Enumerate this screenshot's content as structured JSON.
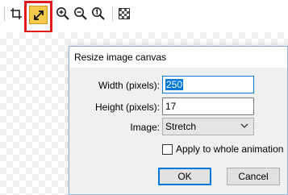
{
  "toolbar": {
    "items": [
      "crop-icon",
      "resize-icon",
      "zoom-in-icon",
      "zoom-out-icon",
      "actual-size-icon",
      "checkerboard-icon"
    ]
  },
  "dialog": {
    "title": "Resize image canvas",
    "width_label": "Width (pixels):",
    "width_value": "250",
    "height_label": "Height (pixels):",
    "height_value": "17",
    "image_label": "Image:",
    "image_value": "Stretch",
    "checkbox_label": "Apply to whole animation",
    "checkbox_checked": false,
    "ok_label": "OK",
    "cancel_label": "Cancel"
  },
  "colors": {
    "highlight": "#e01b1b",
    "active_button": "#f7c94a",
    "accent": "#0078d7"
  }
}
